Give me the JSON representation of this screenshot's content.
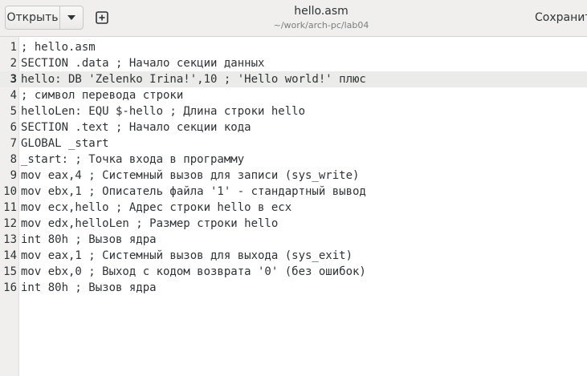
{
  "header": {
    "open_label": "Открыть",
    "title": "hello.asm",
    "subtitle": "~/work/arch-pc/lab04",
    "save_label": "Сохранить"
  },
  "editor": {
    "current_line": 3,
    "lines": [
      {
        "n": "1",
        "text": "; hello.asm"
      },
      {
        "n": "2",
        "text": "SECTION .data ; Начало секции данных"
      },
      {
        "n": "3",
        "text": "hello: DB 'Zelenko Irina!',10 ; 'Hello world!' плюс"
      },
      {
        "n": "4",
        "text": "; символ перевода строки"
      },
      {
        "n": "5",
        "text": "helloLen: EQU $-hello ; Длина строки hello"
      },
      {
        "n": "6",
        "text": "SECTION .text ; Начало секции кода"
      },
      {
        "n": "7",
        "text": "GLOBAL _start"
      },
      {
        "n": "8",
        "text": "_start: ; Точка входа в программу"
      },
      {
        "n": "9",
        "text": "mov eax,4 ; Системный вызов для записи (sys_write)"
      },
      {
        "n": "10",
        "text": "mov ebx,1 ; Описатель файла '1' - стандартный вывод"
      },
      {
        "n": "11",
        "text": "mov ecx,hello ; Адрес строки hello в ecx"
      },
      {
        "n": "12",
        "text": "mov edx,helloLen ; Размер строки hello"
      },
      {
        "n": "13",
        "text": "int 80h ; Вызов ядра"
      },
      {
        "n": "14",
        "text": "mov eax,1 ; Системный вызов для выхода (sys_exit)"
      },
      {
        "n": "15",
        "text": "mov ebx,0 ; Выход с кодом возврата '0' (без ошибок)"
      },
      {
        "n": "16",
        "text": "int 80h ; Вызов ядра"
      }
    ]
  },
  "icons": {
    "open_menu": "chevron-down-icon",
    "new_tab": "plus-square-icon"
  }
}
